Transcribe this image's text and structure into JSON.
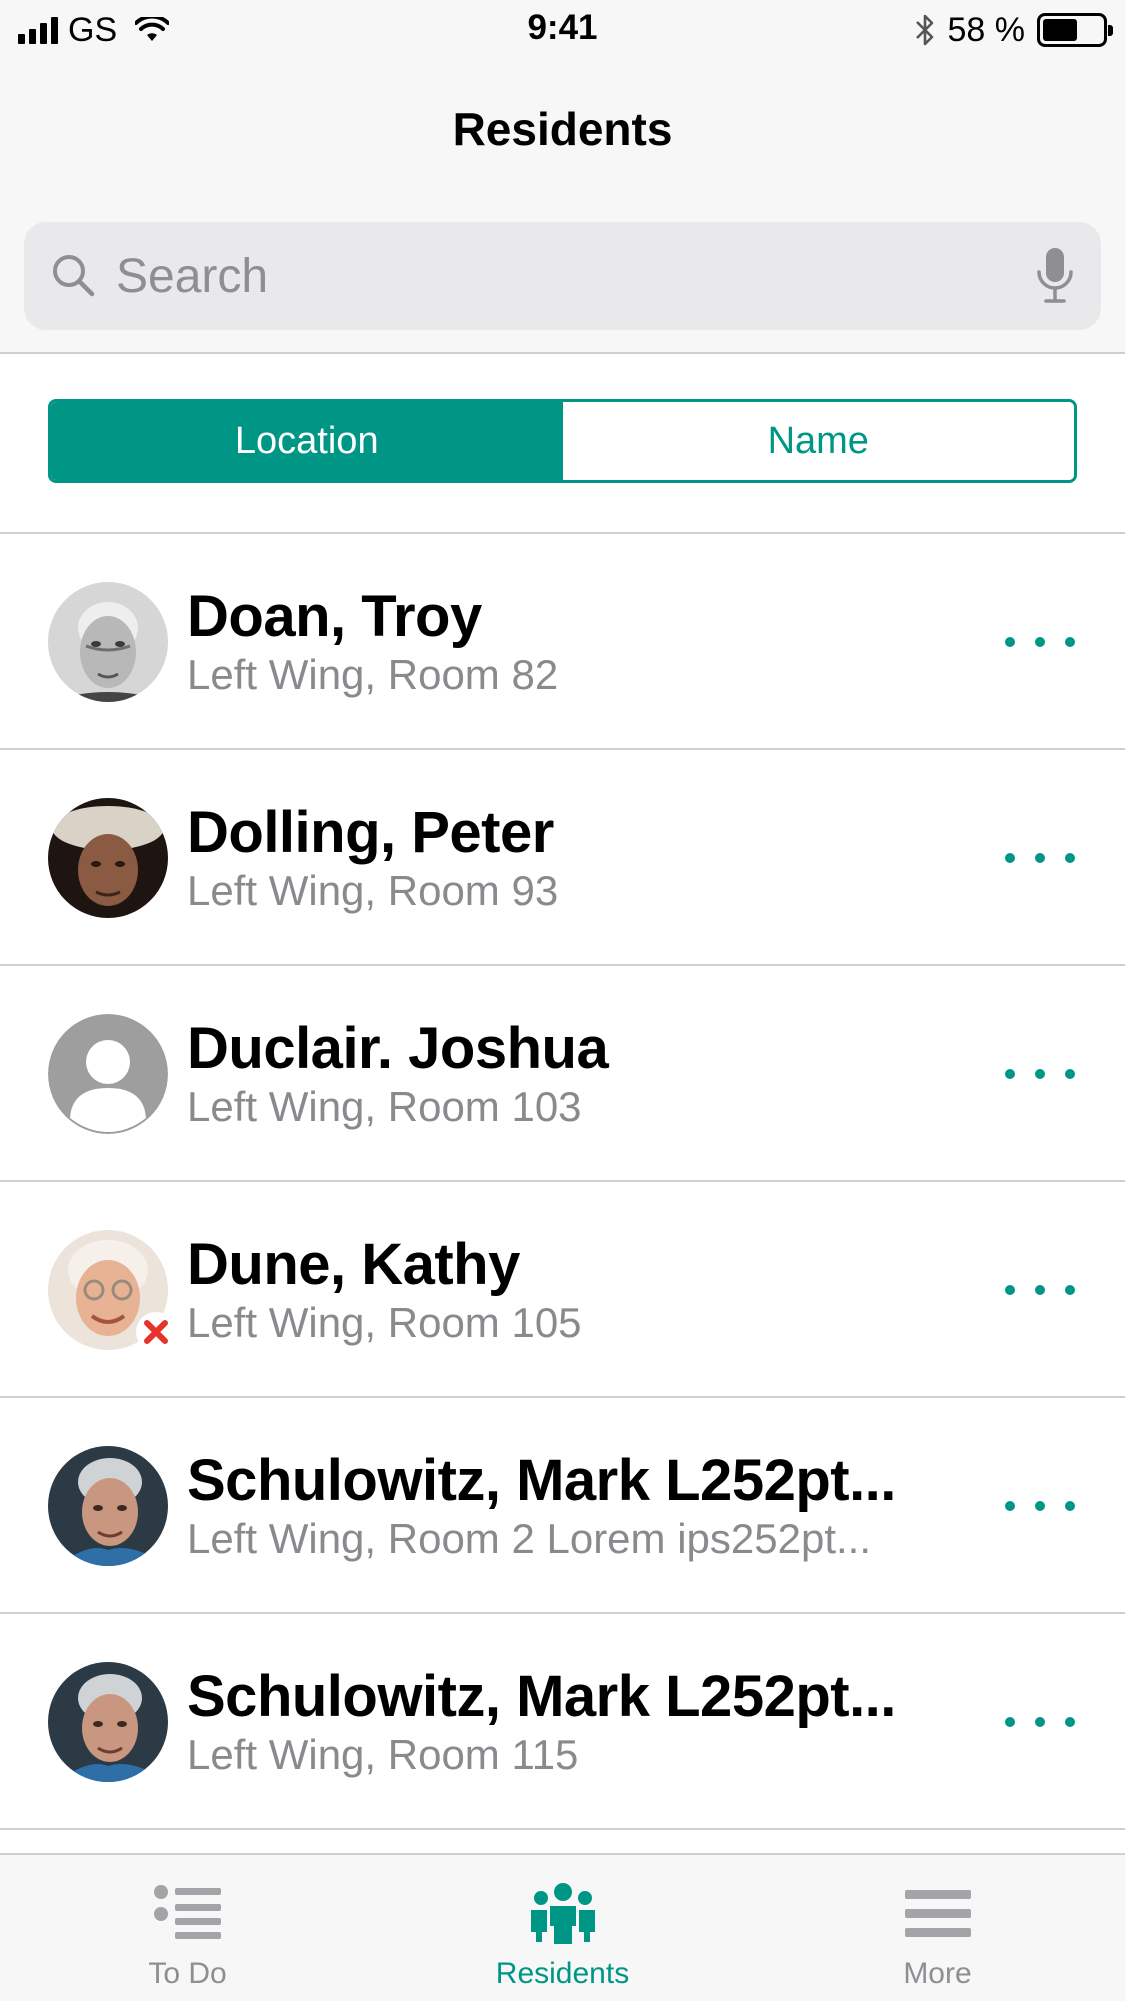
{
  "status_bar": {
    "carrier": "GS",
    "time": "9:41",
    "battery_percent": "58 %",
    "battery_level": 0.58
  },
  "header": {
    "title": "Residents"
  },
  "search": {
    "placeholder": "Search"
  },
  "segments": [
    {
      "label": "Location",
      "selected": true
    },
    {
      "label": "Name",
      "selected": false
    }
  ],
  "residents": [
    {
      "name": "Doan, Troy",
      "location": "Left Wing, Room 82",
      "avatar": "photo-elderly-man-grayscale"
    },
    {
      "name": "Dolling, Peter",
      "location": "Left Wing, Room 93",
      "avatar": "photo-elderly-man-hat"
    },
    {
      "name": "Duclair. Joshua",
      "location": "Left Wing, Room 103",
      "avatar": "placeholder-person"
    },
    {
      "name": "Dune, Kathy",
      "location": "Left Wing, Room 105",
      "avatar": "photo-elderly-woman",
      "status_badge": "red-x"
    },
    {
      "name": "Schulowitz, Mark L252pt...",
      "location": "Left Wing, Room 2 Lorem ips252pt...",
      "avatar": "photo-elderly-man-blue-shirt"
    },
    {
      "name": "Schulowitz, Mark L252pt...",
      "location": "Left Wing, Room 115",
      "avatar": "photo-elderly-man-blue-shirt"
    }
  ],
  "tabs": [
    {
      "label": "To Do",
      "icon": "list-icon",
      "active": false
    },
    {
      "label": "Residents",
      "icon": "people-icon",
      "active": true
    },
    {
      "label": "More",
      "icon": "menu-icon",
      "active": false
    }
  ],
  "colors": {
    "accent": "#009686",
    "secondary_text": "#8a8a8e",
    "separator": "#cfcfd2",
    "bar_background": "#f7f7f7",
    "badge_red": "#e8332a"
  }
}
